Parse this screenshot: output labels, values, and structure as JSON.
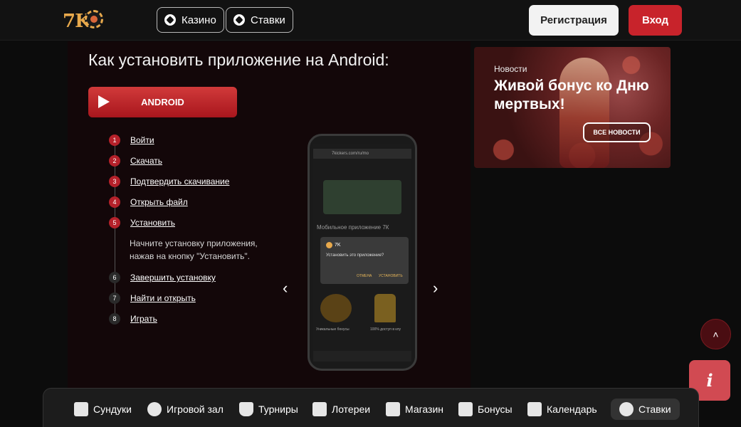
{
  "header": {
    "nav": [
      {
        "label": "Казино",
        "icon": "roulette-icon"
      },
      {
        "label": "Ставки",
        "icon": "soccer-ball-icon"
      }
    ],
    "register_label": "Регистрация",
    "login_label": "Вход"
  },
  "main": {
    "title": "Как установить приложение на Android:",
    "android_button": "ANDROID",
    "steps": [
      {
        "num": "1",
        "label": "Войти"
      },
      {
        "num": "2",
        "label": "Скачать"
      },
      {
        "num": "3",
        "label": "Подтвердить скачивание"
      },
      {
        "num": "4",
        "label": "Открыть файл"
      },
      {
        "num": "5",
        "label": "Установить"
      },
      {
        "num": "6",
        "label": "Завершить установку"
      },
      {
        "num": "7",
        "label": "Найти и открыть"
      },
      {
        "num": "8",
        "label": "Играть"
      }
    ],
    "step_desc": "Начните установку приложения, нажав на кнопку \"Установить\".",
    "phone": {
      "url": "7kickers.com/ru/mo",
      "app_title": "Мобильное приложение 7К",
      "dialog_app": "7K",
      "dialog_question": "Установить это приложение?",
      "dialog_cancel": "ОТМЕНА",
      "dialog_install": "УСТАНОВИТЬ",
      "feature1": "Уникальные бонусы",
      "feature2": "100% доступ в клу"
    },
    "prev_arrow": "‹",
    "next_arrow": "›"
  },
  "news": {
    "tag": "Новости",
    "title": "Живой бонус ко Дню мертвых!",
    "all_button": "ВСЕ НОВОСТИ"
  },
  "floating": {
    "scroll_top": "˄",
    "info": "i"
  },
  "bottom_nav": [
    {
      "label": "Сундуки",
      "icon": "chest-icon"
    },
    {
      "label": "Игровой зал",
      "icon": "chip-icon"
    },
    {
      "label": "Турниры",
      "icon": "trophy-icon"
    },
    {
      "label": "Лотереи",
      "icon": "ticket-icon"
    },
    {
      "label": "Магазин",
      "icon": "shop-bag-icon"
    },
    {
      "label": "Бонусы",
      "icon": "gift-icon"
    },
    {
      "label": "Календарь",
      "icon": "calendar-icon"
    },
    {
      "label": "Ставки",
      "icon": "soccer-ball-icon",
      "active": true
    }
  ],
  "colors": {
    "accent_red": "#c8232b",
    "logo_gold": "#e8a94c",
    "background": "#0c0c0c"
  }
}
